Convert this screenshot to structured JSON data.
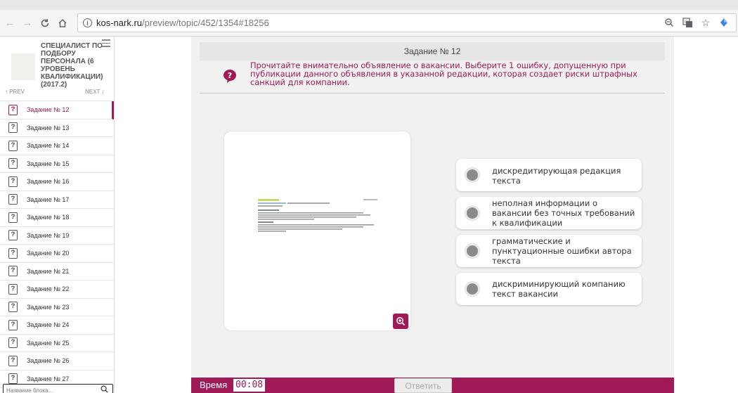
{
  "browser": {
    "url_host": "kos-nark.ru",
    "url_path": "/preview/topic/452/1354#18256",
    "icons": [
      "back-icon",
      "forward-icon",
      "reload-icon",
      "home-icon",
      "info-icon",
      "zoom-icon",
      "translate-icon",
      "star-icon",
      "extension-icon"
    ]
  },
  "sidebar": {
    "course_title": "СПЕЦИАЛИСТ ПО ПОДБОРУ ПЕРСОНАЛА (6 УРОВЕНЬ КВАЛИФИКАЦИИ) (2017.2)",
    "prev_label": "↑ PREV",
    "next_label": "NEXT ↓",
    "tasks": [
      {
        "label": "Задание № 12",
        "active": true
      },
      {
        "label": "Задание № 13"
      },
      {
        "label": "Задание № 14"
      },
      {
        "label": "Задание № 15"
      },
      {
        "label": "Задание № 16"
      },
      {
        "label": "Задание № 17"
      },
      {
        "label": "Задание № 18"
      },
      {
        "label": "Задание № 19"
      },
      {
        "label": "Задание № 20"
      },
      {
        "label": "Задание № 21"
      },
      {
        "label": "Задание № 22"
      },
      {
        "label": "Задание № 23"
      },
      {
        "label": "Задание № 24"
      },
      {
        "label": "Задание № 25"
      },
      {
        "label": "Задание № 26"
      },
      {
        "label": "Задание № 27"
      }
    ],
    "search_placeholder": "Название блока..."
  },
  "task": {
    "number_label": "Задание № 12",
    "question": "Прочитайте внимательно объявление о вакансии. Выберите 1 ошибку, допущенную при публикации данного объявления в указанной редакции, которая создает риски штрафных санкций для компании.",
    "options": [
      "дискредитирующая редакция текста",
      "неполная информации о вакансии без точных требований к квалификации",
      "грамматические и пунктуационные ошибки автора текста",
      "дискриминирующий компанию текст вакансии"
    ]
  },
  "footer": {
    "time_label": "Время",
    "time_value": "00:08",
    "answer_label": "Ответить"
  },
  "colors": {
    "accent": "#a01a58",
    "stage_bg": "#f1f1f1"
  }
}
